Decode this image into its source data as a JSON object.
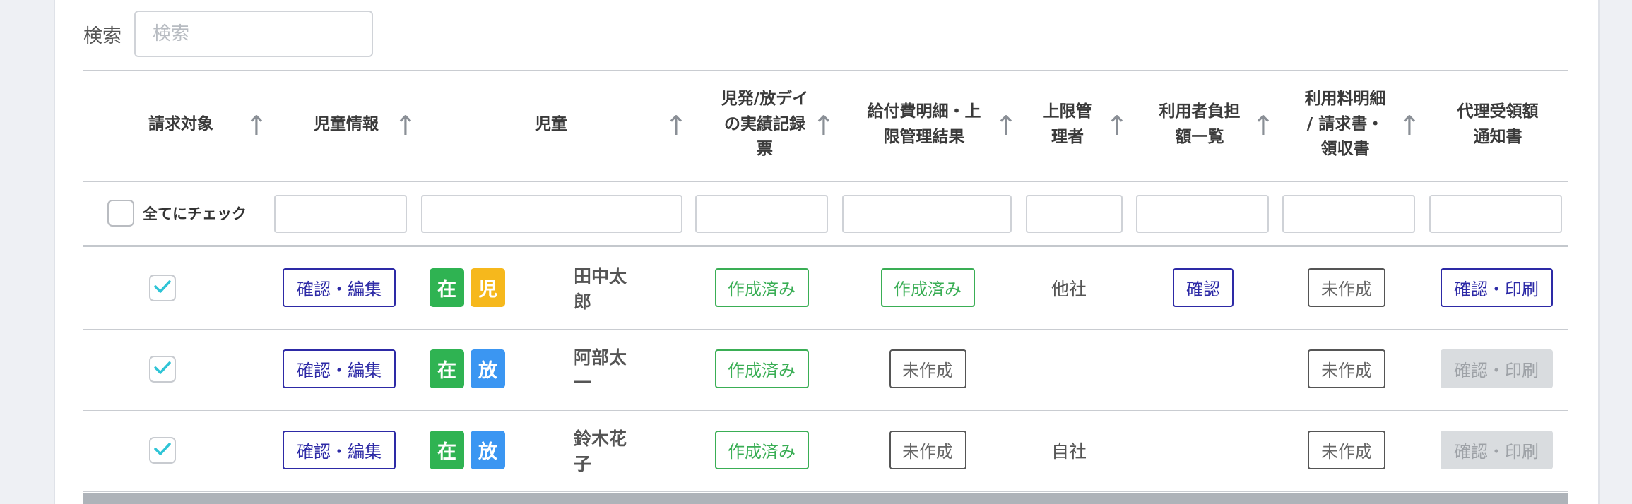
{
  "search": {
    "label": "検索",
    "placeholder": "検索",
    "value": ""
  },
  "columns": [
    {
      "label": "請求対象",
      "sortable": true
    },
    {
      "label": "児童情報",
      "sortable": true
    },
    {
      "label": "児童",
      "sortable": true
    },
    {
      "label": "児発/放デイの実績記録票",
      "sortable": true
    },
    {
      "label": "給付費明細・上限管理結果",
      "sortable": true
    },
    {
      "label": "上限管理者",
      "sortable": true
    },
    {
      "label": "利用者負担額一覧",
      "sortable": true
    },
    {
      "label": "利用料明細/請求書・領収書",
      "sortable": true
    },
    {
      "label": "代理受領額通知書",
      "sortable": false
    }
  ],
  "header_lines": {
    "h0": [
      "請求対象"
    ],
    "h1": [
      "児童情報"
    ],
    "h2": [
      "児童"
    ],
    "h3": [
      "児発/放デイ",
      "の実績記録",
      "票"
    ],
    "h4": [
      "給付費明細・上",
      "限管理結果"
    ],
    "h5": [
      "上限管",
      "理者"
    ],
    "h6": [
      "利用者負担",
      "額一覧"
    ],
    "h7": [
      "利用料明細",
      "/ 請求書・",
      "領収書"
    ],
    "h8": [
      "代理受領額",
      "通知書"
    ]
  },
  "sort_icon": "arrow-up-icon",
  "filter": {
    "check_all_label": "全てにチェック",
    "check_all_checked": false
  },
  "colors": {
    "purple": "#2d2aa6",
    "green": "#3aae55",
    "tag_green": "#2fb352",
    "tag_yellow": "#f6b81c",
    "tag_blue": "#3b96f2",
    "check": "#2ec4d6"
  },
  "rows": [
    {
      "checked": true,
      "info_button": "確認・編集",
      "tags": [
        {
          "text": "在",
          "color": "green"
        },
        {
          "text": "児",
          "color": "yellow"
        }
      ],
      "name": "田中太郎",
      "record": {
        "label": "作成済み",
        "style": "green"
      },
      "benefit": {
        "label": "作成済み",
        "style": "green"
      },
      "limit_manager": "他社",
      "burden": {
        "label": "確認",
        "style": "purple"
      },
      "invoice": {
        "label": "未作成",
        "style": "gray"
      },
      "notice": {
        "label": "確認・印刷",
        "style": "purple"
      }
    },
    {
      "checked": true,
      "info_button": "確認・編集",
      "tags": [
        {
          "text": "在",
          "color": "green"
        },
        {
          "text": "放",
          "color": "blue"
        }
      ],
      "name": "阿部太一",
      "record": {
        "label": "作成済み",
        "style": "green"
      },
      "benefit": {
        "label": "未作成",
        "style": "gray"
      },
      "limit_manager": "",
      "burden": null,
      "invoice": {
        "label": "未作成",
        "style": "gray"
      },
      "notice": {
        "label": "確認・印刷",
        "style": "disabled"
      }
    },
    {
      "checked": true,
      "info_button": "確認・編集",
      "tags": [
        {
          "text": "在",
          "color": "green"
        },
        {
          "text": "放",
          "color": "blue"
        }
      ],
      "name": "鈴木花子",
      "record": {
        "label": "作成済み",
        "style": "green"
      },
      "benefit": {
        "label": "未作成",
        "style": "gray"
      },
      "limit_manager": "自社",
      "burden": null,
      "invoice": {
        "label": "未作成",
        "style": "gray"
      },
      "notice": {
        "label": "確認・印刷",
        "style": "disabled"
      }
    }
  ]
}
